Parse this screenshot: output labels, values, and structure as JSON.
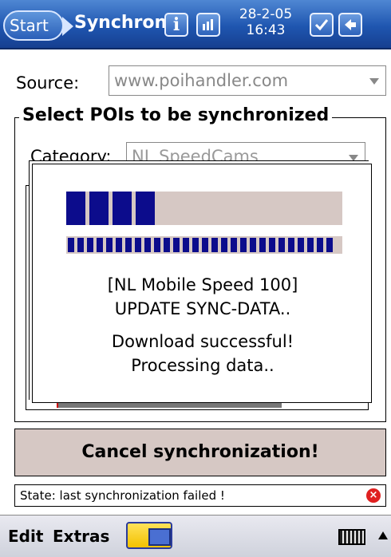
{
  "titlebar": {
    "start_label": "Start",
    "app_title": "Synchroni",
    "info_icon": "info-icon",
    "signal_icon": "signal-icon",
    "date": "28-2-05",
    "time": "16:43",
    "ok_icon": "checklist-icon",
    "back_icon": "back-icon"
  },
  "form": {
    "source_label": "Source:",
    "source_value": "www.poihandler.com",
    "group_title": "Select POIs to be synchronized",
    "category_label": "Category:",
    "category_value": "NL SpeedCams"
  },
  "dialog": {
    "primary_progress": 0.34,
    "secondary_progress": 1.0,
    "line1": "[NL Mobile Speed 100]",
    "line2": "UPDATE SYNC-DATA..",
    "line3": "Download successful!",
    "line4": "Processing data.."
  },
  "actions": {
    "cancel_label": "Cancel synchronization!"
  },
  "status": {
    "text": "State: last synchronization failed !",
    "icon": "error-icon"
  },
  "menubar": {
    "edit_label": "Edit",
    "extras_label": "Extras",
    "sync_icon": "sync-icon",
    "keyboard_icon": "keyboard-icon"
  },
  "colors": {
    "titlebar": "#1f56b0",
    "progress_fill": "#0c0c8c",
    "progress_track": "#d6c8c4",
    "button_face": "#d6c8c4",
    "error": "#e02020"
  }
}
